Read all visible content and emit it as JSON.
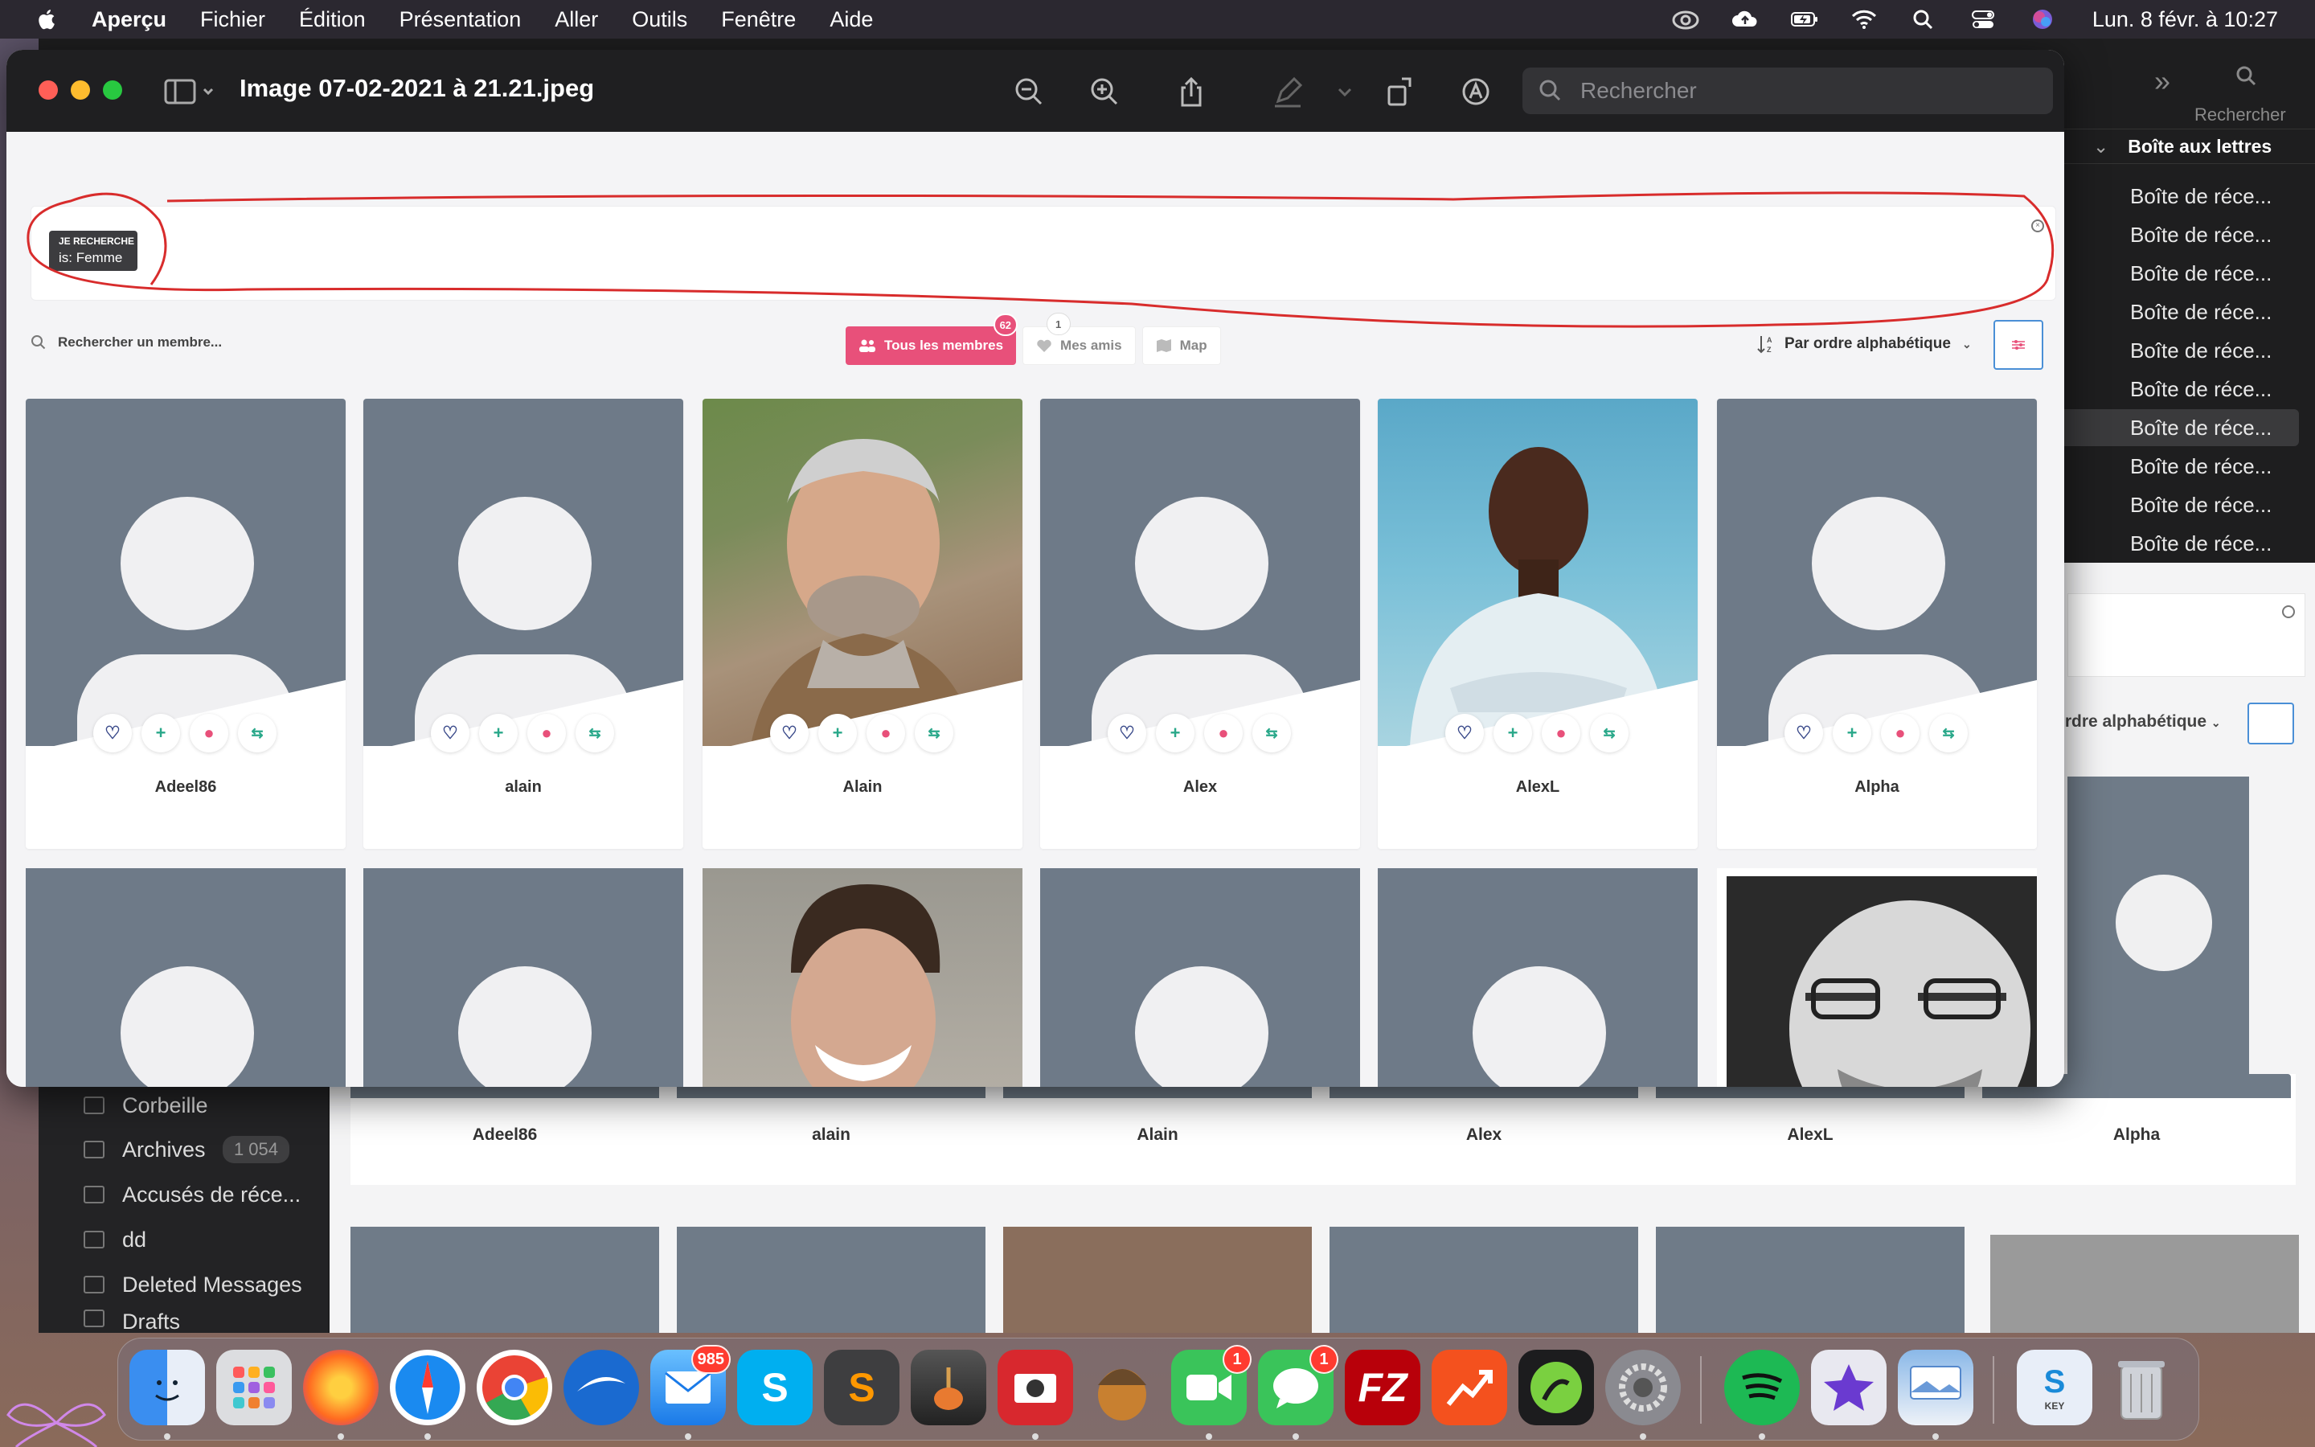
{
  "menubar": {
    "app_name": "Aperçu",
    "items": [
      "Fichier",
      "Édition",
      "Présentation",
      "Aller",
      "Outils",
      "Fenêtre",
      "Aide"
    ],
    "clock": "Lun. 8 févr. à  10:27"
  },
  "preview": {
    "title": "Image 07-02-2021 à 21.21.jpeg",
    "search_placeholder": "Rechercher"
  },
  "site": {
    "filter_tag_label": "JE RECHERCHE",
    "filter_tag_value": "is: Femme",
    "member_search_placeholder": "Rechercher un membre...",
    "tabs": [
      {
        "label": "Tous les membres",
        "badge": "62"
      },
      {
        "label": "Mes amis",
        "badge": "1"
      },
      {
        "label": "Map",
        "badge": ""
      }
    ],
    "sort_label": "Par ordre alphabétique",
    "members": [
      "Adeel86",
      "alain",
      "Alain",
      "Alex",
      "AlexL",
      "Alpha"
    ]
  },
  "mail": {
    "toolbar_search_label": "Rechercher",
    "header": "Boîte aux lettres",
    "mailbox_items": [
      "Boîte de réce...",
      "Boîte de réce...",
      "Boîte de réce...",
      "Boîte de réce...",
      "Boîte de réce...",
      "Boîte de réce...",
      "Boîte de réce...",
      "Boîte de réce...",
      "Boîte de réce...",
      "Boîte de réce..."
    ],
    "sidebar": [
      {
        "label": "Corbeille",
        "count": ""
      },
      {
        "label": "Archives",
        "count": "1 054"
      },
      {
        "label": "Accusés de réce...",
        "count": ""
      },
      {
        "label": "dd",
        "count": ""
      },
      {
        "label": "Deleted Messages",
        "count": ""
      },
      {
        "label": "Drafts",
        "count": ""
      }
    ],
    "sort_label": "ordre alphabétique"
  },
  "dock": {
    "mail_badge": "985",
    "facetime_badge": "1",
    "messages_badge": "1",
    "keynote_label": "KEY"
  },
  "colors": {
    "accent_pink": "#e8507a",
    "filter_blue": "#4a8fd6",
    "placeholder_grey": "#6e7a88",
    "annotation_red": "#d82c2c"
  }
}
